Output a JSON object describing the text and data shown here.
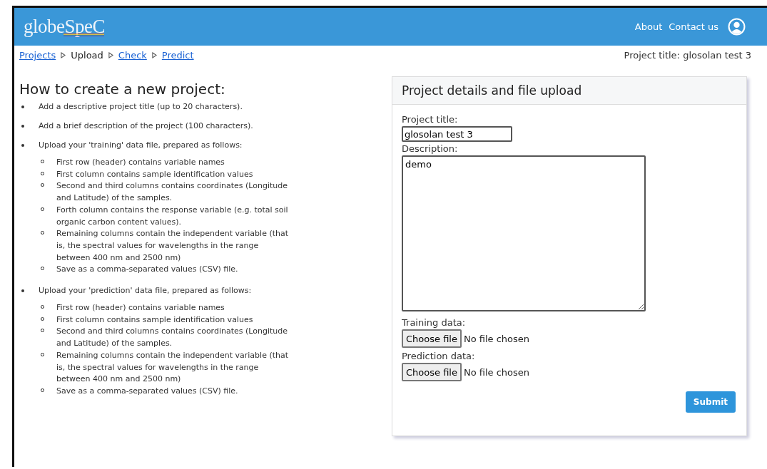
{
  "header": {
    "logo": "globeSpeC",
    "links": [
      "About",
      "Contact us"
    ]
  },
  "breadcrumb": [
    {
      "label": "Projects",
      "kind": "link"
    },
    {
      "label": "Upload",
      "kind": "current"
    },
    {
      "label": "Check",
      "kind": "link"
    },
    {
      "label": "Predict",
      "kind": "link"
    }
  ],
  "project_title_status": "Project title: glosolan test 3",
  "instructions": {
    "title": "How to create a new project:",
    "steps": [
      {
        "text": "Add a descriptive project title (up to 20 characters)."
      },
      {
        "text": "Add a brief description of the project (100 characters)."
      },
      {
        "text": "Upload your 'training' data file, prepared as follows:",
        "children": [
          {
            "text": "First row (header) contains variable names"
          },
          {
            "text": "First column contains sample identification values"
          },
          {
            "text": "Second and third columns contains coordinates (Longitude and Latitude) of the samples."
          },
          {
            "text": "Forth column contains the response variable (e.g. total soil organic carbon content values)."
          },
          {
            "text": "Remaining columns contain the independent variable (that is, the spectral values for wavelengths in the range between 400 nm and 2500 nm)"
          },
          {
            "text": "Save as a comma-separated values (CSV) file."
          }
        ]
      },
      {
        "text": "Upload your 'prediction' data file, prepared as follows:",
        "children": [
          {
            "text": "First row (header) contains variable names"
          },
          {
            "text": "First column contains sample identification values"
          },
          {
            "text": "Second and third columns contains coordinates (Longitude and Latitude) of the samples."
          },
          {
            "text": "Remaining columns contain the independent variable (that is, the spectral values for wavelengths in the range between 400 nm and 2500 nm)"
          },
          {
            "text": "Save as a comma-separated values (CSV) file."
          }
        ]
      }
    ]
  },
  "form": {
    "title": "Project details and file upload",
    "fields": [
      {
        "kind": "text",
        "label": "Project title:",
        "value": "glosolan test 3"
      },
      {
        "kind": "textarea",
        "label": "Description:",
        "value": "demo"
      },
      {
        "kind": "file",
        "label": "Training data:",
        "button": "Choose file",
        "status": "No file chosen"
      },
      {
        "kind": "file",
        "label": "Prediction data:",
        "button": "Choose file",
        "status": "No file chosen"
      }
    ],
    "submit": "Submit"
  }
}
